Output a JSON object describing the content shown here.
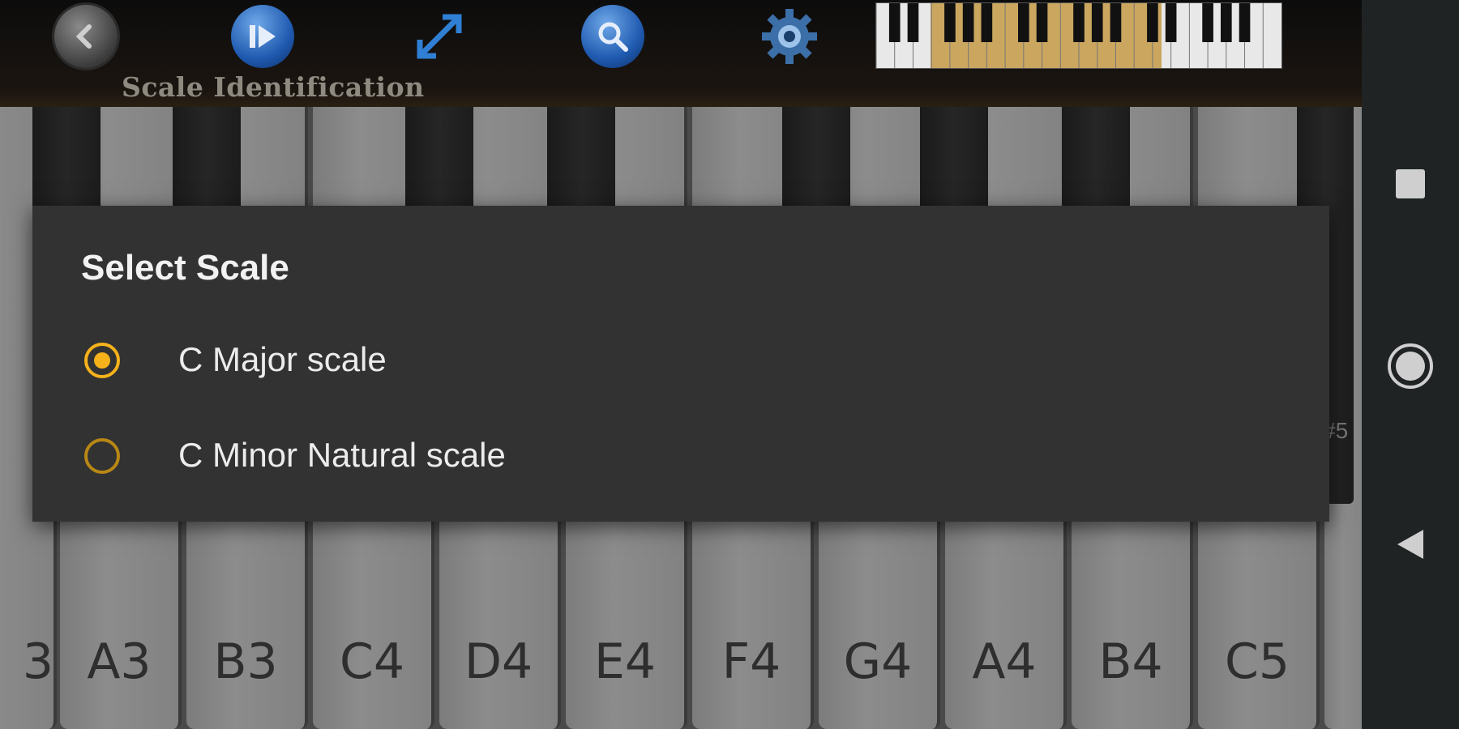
{
  "toolbar": {
    "title": "Scale Identification",
    "buttons": [
      {
        "name": "back",
        "icon": "back-arrow-icon"
      },
      {
        "name": "play",
        "icon": "play-pause-icon"
      },
      {
        "name": "expand",
        "icon": "expand-arrows-icon"
      },
      {
        "name": "search",
        "icon": "search-icon"
      },
      {
        "name": "settings",
        "icon": "gear-icon"
      }
    ]
  },
  "piano": {
    "white_keys": [
      "3",
      "A3",
      "B3",
      "C4",
      "D4",
      "E4",
      "F4",
      "G4",
      "A4",
      "B4",
      "C5"
    ],
    "partial_hint": "#5"
  },
  "dialog": {
    "title": "Select Scale",
    "options": [
      {
        "label": "C Major scale",
        "selected": true
      },
      {
        "label": "C Minor Natural scale",
        "selected": false
      }
    ],
    "accent_color": "#f6b21b"
  },
  "navbar": {
    "buttons": [
      "recents-icon",
      "home-icon",
      "nav-back-icon"
    ]
  }
}
